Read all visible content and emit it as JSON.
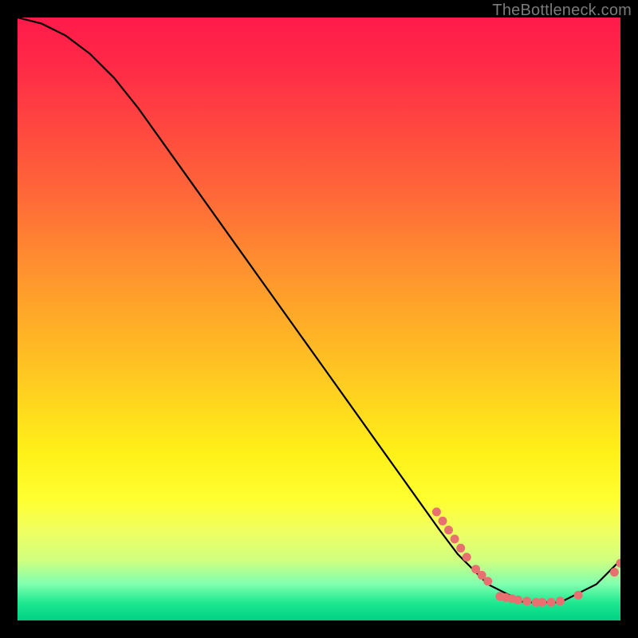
{
  "watermark": "TheBottleneck.com",
  "chart_data": {
    "type": "line",
    "title": "",
    "xlabel": "",
    "ylabel": "",
    "xlim": [
      0,
      100
    ],
    "ylim": [
      0,
      100
    ],
    "series": [
      {
        "name": "curve",
        "x": [
          0,
          4,
          8,
          12,
          16,
          20,
          25,
          30,
          35,
          40,
          45,
          50,
          55,
          60,
          65,
          70,
          73,
          76,
          78,
          80,
          82,
          84,
          86,
          88,
          90,
          92,
          94,
          96,
          98,
          100
        ],
        "y": [
          100,
          99,
          97,
          94,
          90,
          85,
          78,
          71,
          64,
          57,
          50,
          43,
          36,
          29,
          22,
          15,
          11,
          8,
          6,
          5,
          4,
          3,
          3,
          3,
          3,
          4,
          5,
          6,
          8,
          10
        ]
      }
    ],
    "markers": {
      "name": "dots",
      "color": "#e87070",
      "points": [
        {
          "x": 69.5,
          "y": 18.0
        },
        {
          "x": 70.5,
          "y": 16.5
        },
        {
          "x": 71.5,
          "y": 15.0
        },
        {
          "x": 72.5,
          "y": 13.5
        },
        {
          "x": 73.5,
          "y": 12.0
        },
        {
          "x": 74.5,
          "y": 10.5
        },
        {
          "x": 76.0,
          "y": 8.5
        },
        {
          "x": 77.0,
          "y": 7.5
        },
        {
          "x": 78.0,
          "y": 6.5
        },
        {
          "x": 80.0,
          "y": 4.0
        },
        {
          "x": 81.0,
          "y": 3.8
        },
        {
          "x": 82.0,
          "y": 3.6
        },
        {
          "x": 83.0,
          "y": 3.4
        },
        {
          "x": 84.5,
          "y": 3.2
        },
        {
          "x": 86.0,
          "y": 3.0
        },
        {
          "x": 87.0,
          "y": 3.0
        },
        {
          "x": 88.5,
          "y": 3.0
        },
        {
          "x": 90.0,
          "y": 3.2
        },
        {
          "x": 93.0,
          "y": 4.2
        },
        {
          "x": 99.0,
          "y": 8.0
        },
        {
          "x": 100.0,
          "y": 9.5
        }
      ]
    }
  }
}
